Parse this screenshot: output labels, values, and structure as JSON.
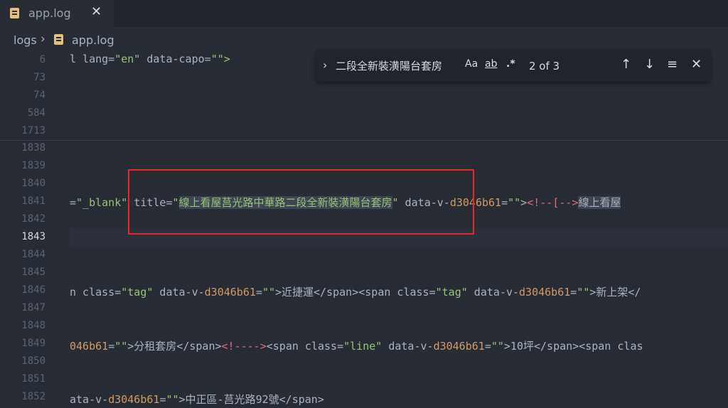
{
  "tab": {
    "title": "app.log",
    "close": "✕"
  },
  "breadcrumb": {
    "folder": "logs",
    "separator": "›",
    "file": "app.log"
  },
  "gutter": {
    "lines": [
      "6",
      "73",
      "74",
      "584",
      "1713",
      "1838",
      "1839",
      "1840",
      "1841",
      "1842",
      "1843",
      "1844",
      "1845",
      "1846",
      "1847",
      "1848",
      "1849",
      "1850",
      "1851",
      "1852"
    ],
    "active_line": "1843"
  },
  "code": {
    "l6": {
      "a": "l lang=",
      "b": "\"en\"",
      "c": " data-capo=",
      "d": "\"\">"
    },
    "l1841": {
      "a": "=",
      "b": "\"_blank\"",
      "c": " title=",
      "d": "\"",
      "e": "線上看屋莒光路中華路二段全新裝潢陽台套房",
      "f": "\"",
      "g": " data-v-",
      "h": "d3046b61",
      "i": "=",
      "j": "\"\"",
      "k": ">",
      "l": "<!--[-->",
      "m": "線上看屋"
    },
    "l1846": {
      "a": "n class=",
      "b": "\"tag\"",
      "c": " data-v-",
      "d": "d3046b61",
      "e": "=",
      "f": "\"\"",
      "g": ">近捷運</span><span class=",
      "h": "\"tag\"",
      "i": " data-v-",
      "j": "d3046b61",
      "k": "=",
      "l": "\"\"",
      "m": ">新上架</"
    },
    "l1849": {
      "a": "046b61",
      "b": "=",
      "c": "\"\"",
      "d": ">分租套房</span>",
      "e": "<!---->",
      "f": "<span class=",
      "g": "\"line\"",
      "h": " data-v-",
      "i": "d3046b61",
      "j": "=",
      "k": "\"\"",
      "l": ">10坪</span><span clas"
    },
    "l1852": {
      "a": "ata-v-",
      "b": "d3046b61",
      "c": "=",
      "d": "\"\"",
      "e": ">中正區-莒光路92號</span>"
    }
  },
  "find": {
    "toggle": "›",
    "query": "二段全新裝潢陽台套房",
    "match_case": "Aa",
    "whole_word": "ab",
    "regex": ".*",
    "count": "2 of 3",
    "prev": "↑",
    "next": "↓",
    "find_in_selection": "≡",
    "close": "✕"
  }
}
